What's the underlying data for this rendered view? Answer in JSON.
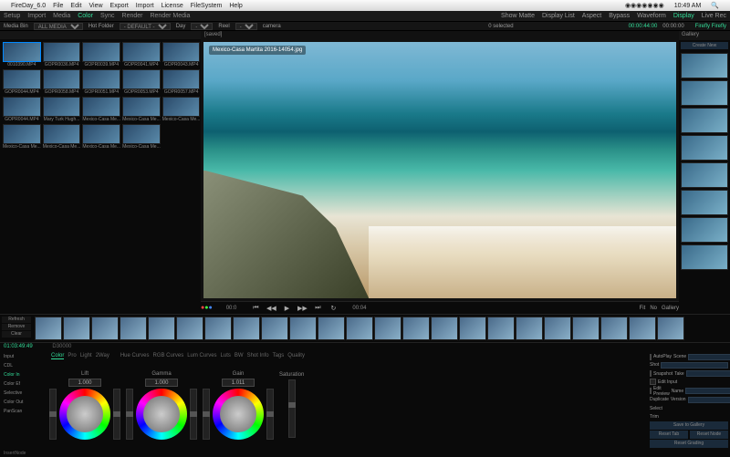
{
  "menubar": {
    "app": "FireDay_6.0",
    "items": [
      "File",
      "Edit",
      "View",
      "Export",
      "Import",
      "License",
      "FileSystem",
      "Help"
    ],
    "clock": "10:49 AM"
  },
  "toolbar": {
    "tabs": [
      "Setup",
      "Import",
      "Media",
      "Color",
      "Sync",
      "Render",
      "Render Media"
    ],
    "sel": "Color",
    "right": [
      "Show Matte",
      "Display List",
      "Aspect",
      "Bypass",
      "Waveform",
      "Display",
      "Live Rec"
    ]
  },
  "subbar": {
    "media_bin_lbl": "Media Bin",
    "all": "ALL MEDIA",
    "hot_lbl": "Hot Folder",
    "hot": "- DEFAULT -",
    "reel_lbl": "Reel",
    "day_lbl": "Day",
    "camera_lbl": "camera",
    "selected": "0 selected",
    "tc1": "00:00:44:00",
    "tc2": "00:00:00"
  },
  "bin": {
    "clips": [
      "0010390.MP4",
      "GOPR0036.MP4",
      "GOPR0039.MP4",
      "GOPR0041.MP4",
      "GOPR0043.MP4",
      "GOPR0044.MP4",
      "GOPR0058.MP4",
      "GOPR0051.MP4",
      "GOPR0053.MP4",
      "GOPR0057.MP4",
      "GOPR0044.MP4",
      "Mary Turk Hugh...",
      "Mexico-Casa Me...",
      "Mexico-Casa Me...",
      "Mexico-Casa Me...",
      "Mexico-Casa Me...",
      "Mexico-Casa Me...",
      "Mexico-Casa Me...",
      "Mexico-Casa Me..."
    ]
  },
  "viewer": {
    "title": "[saved]",
    "overlay": "Mexico-Casa Martita 2016-14054.jpg",
    "title2": "Firefly Firefly"
  },
  "transport": {
    "in": "00:0",
    "out": "00:04",
    "fit": "Fit",
    "no": "No",
    "gallery": "Gallery"
  },
  "gallery": {
    "title": "Gallery",
    "create": "Create New"
  },
  "timeline": {
    "tc": "01:03:49:49",
    "refresh": "Refresh",
    "remove": "Remove",
    "clear": "Clear",
    "db": "D30000"
  },
  "color": {
    "lefttabs": [
      "Input",
      "CDL",
      "Color In",
      "Color Ef",
      "Selective",
      "Color Out",
      "PanScan"
    ],
    "sel": "Color In",
    "subtabs": [
      "Color",
      "Pro",
      "Light",
      "2Way"
    ],
    "subsel": "Color",
    "modes": [
      "Hue Curves",
      "RGB Curves",
      "Lum Curves",
      "Luts",
      "BW",
      "Shot Info",
      "Tags",
      "Quality"
    ],
    "wheels": [
      {
        "label": "Lift",
        "val": "1.000"
      },
      {
        "label": "Gamma",
        "val": "1.000"
      },
      {
        "label": "Gain",
        "val": "1.011"
      }
    ],
    "sat": "Saturation"
  },
  "right": {
    "autoplay": "AutoPlay",
    "scene": "Scene",
    "shot": "Shot",
    "take": "Take",
    "edit_snapshot": "Snapshot",
    "edit_input": "Edit Input",
    "edit_preview": "Edit Preview",
    "dup": "Duplicate",
    "select": "Select",
    "trim": "Trim",
    "name": "Name",
    "version": "Version",
    "save_gallery": "Save to Gallery",
    "reset_tab": "Reset Tab",
    "reset_node": "Reset Node",
    "reset_grading": "Reset Grading"
  },
  "footer": "InsertNode"
}
